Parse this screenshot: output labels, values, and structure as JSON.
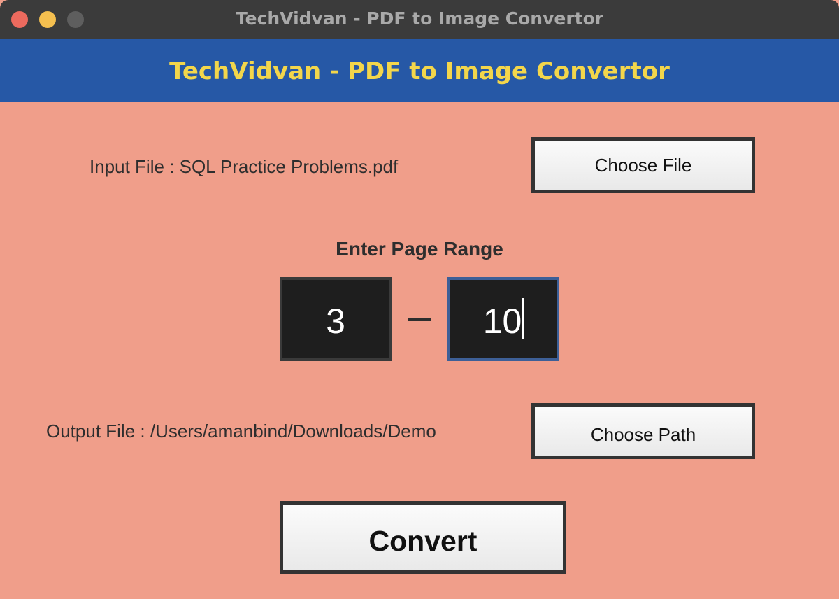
{
  "window": {
    "title": "TechVidvan - PDF to Image Convertor"
  },
  "header": {
    "title": "TechVidvan - PDF to Image Convertor"
  },
  "input": {
    "label": "Input File : SQL Practice Problems.pdf",
    "button_label": "Choose File"
  },
  "range": {
    "heading": "Enter Page Range",
    "start": "3",
    "end": "10"
  },
  "output": {
    "label": "Output File : /Users/amanbind/Downloads/Demo",
    "button_label": "Choose Path"
  },
  "convert": {
    "label": "Convert"
  },
  "colors": {
    "background": "#f09e8a",
    "header_bg": "#2658a6",
    "header_text": "#f3d64b",
    "titlebar": "#3b3b3b",
    "field_bg": "#1e1e1e"
  }
}
